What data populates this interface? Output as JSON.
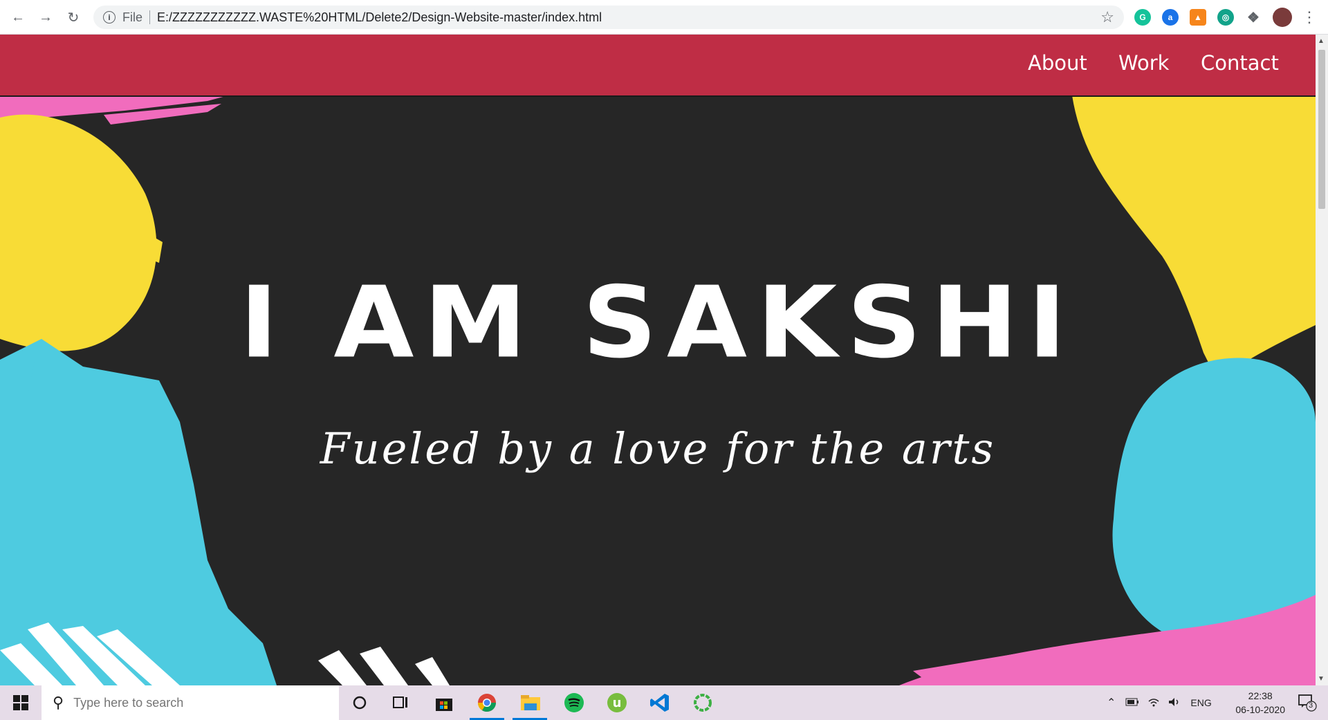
{
  "browser": {
    "back_icon": "arrow-left-icon",
    "forward_icon": "arrow-right-icon",
    "reload_icon": "reload-icon",
    "scheme_label": "File",
    "url": "E:/ZZZZZZZZZZZ.WASTE%20HTML/Delete2/Design-Website-master/index.html",
    "extensions": [
      "grammarly",
      "adblock",
      "metamask",
      "extension",
      "puzzle-extensions"
    ]
  },
  "site": {
    "nav": {
      "about": "About",
      "work": "Work",
      "contact": "Contact"
    },
    "title": "I AM SAKSHI",
    "subtitle": "Fueled by a love for the arts",
    "colors": {
      "nav_bg": "#bf2d45",
      "page_bg": "#262626",
      "yellow": "#f8dc36",
      "cyan": "#4ecbe0",
      "pink": "#f16cbd"
    }
  },
  "taskbar": {
    "search_placeholder": "Type here to search",
    "language": "ENG",
    "time": "22:38",
    "date": "06-10-2020",
    "notifications": "3"
  }
}
